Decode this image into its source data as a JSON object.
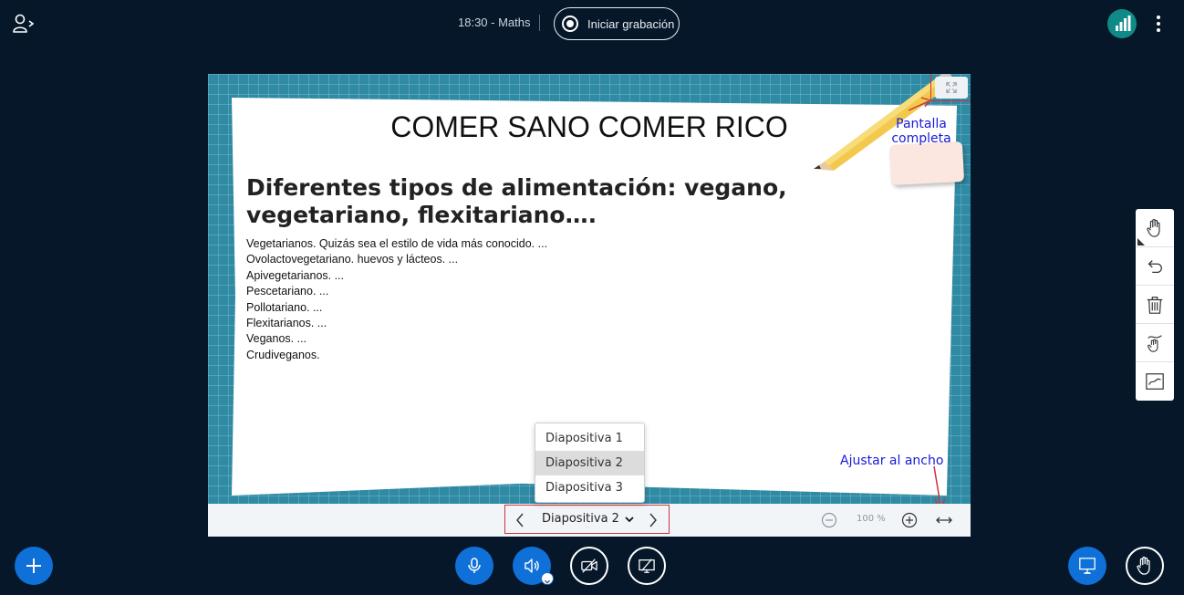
{
  "header": {
    "meeting_title": "18:30 - Maths",
    "record_label": "Iniciar grabación"
  },
  "slide": {
    "title": "COMER SANO COMER RICO",
    "heading": "Diferentes tipos de alimentación: vegano, vegetariano, flexitariano….",
    "items": [
      "Vegetarianos. Quizás sea el estilo de vida más conocido. ...",
      "Ovolactovegetariano.  huevos y lácteos. ...",
      "Apivegetarianos. ...",
      "Pescetariano. ...",
      "Pollotariano. ...",
      "Flexitarianos. ...",
      "Veganos. ...",
      "Crudiveganos."
    ]
  },
  "annotations": {
    "fullscreen": "Pantalla completa",
    "fit_width": "Ajustar al ancho"
  },
  "toolbar": {
    "current_slide": "Diapositiva 2",
    "zoom_level": "100 %"
  },
  "dropdown": {
    "options": [
      "Diapositiva 1",
      "Diapositiva 2",
      "Diapositiva 3"
    ],
    "selected_index": 1
  },
  "colors": {
    "background": "#06172a",
    "accent": "#0f70d7",
    "highlight": "#d0313d",
    "annotation": "#1a1ad6",
    "connection": "#0f8a86"
  },
  "icons": {
    "user": "user-list-icon",
    "connection": "connection-status-icon",
    "more": "kebab-menu-icon",
    "fullscreen": "fullscreen-icon",
    "hand": "hand-tool-icon",
    "undo": "undo-icon",
    "trash": "clear-annotations-icon",
    "multiuser": "multi-user-whiteboard-icon",
    "whiteboard": "whiteboard-icon",
    "plus": "plus-icon",
    "mic": "microphone-icon",
    "audio": "speaker-icon",
    "video": "camera-off-icon",
    "screen": "screenshare-off-icon",
    "presentation": "presentation-icon",
    "raise_hand": "raise-hand-icon"
  }
}
